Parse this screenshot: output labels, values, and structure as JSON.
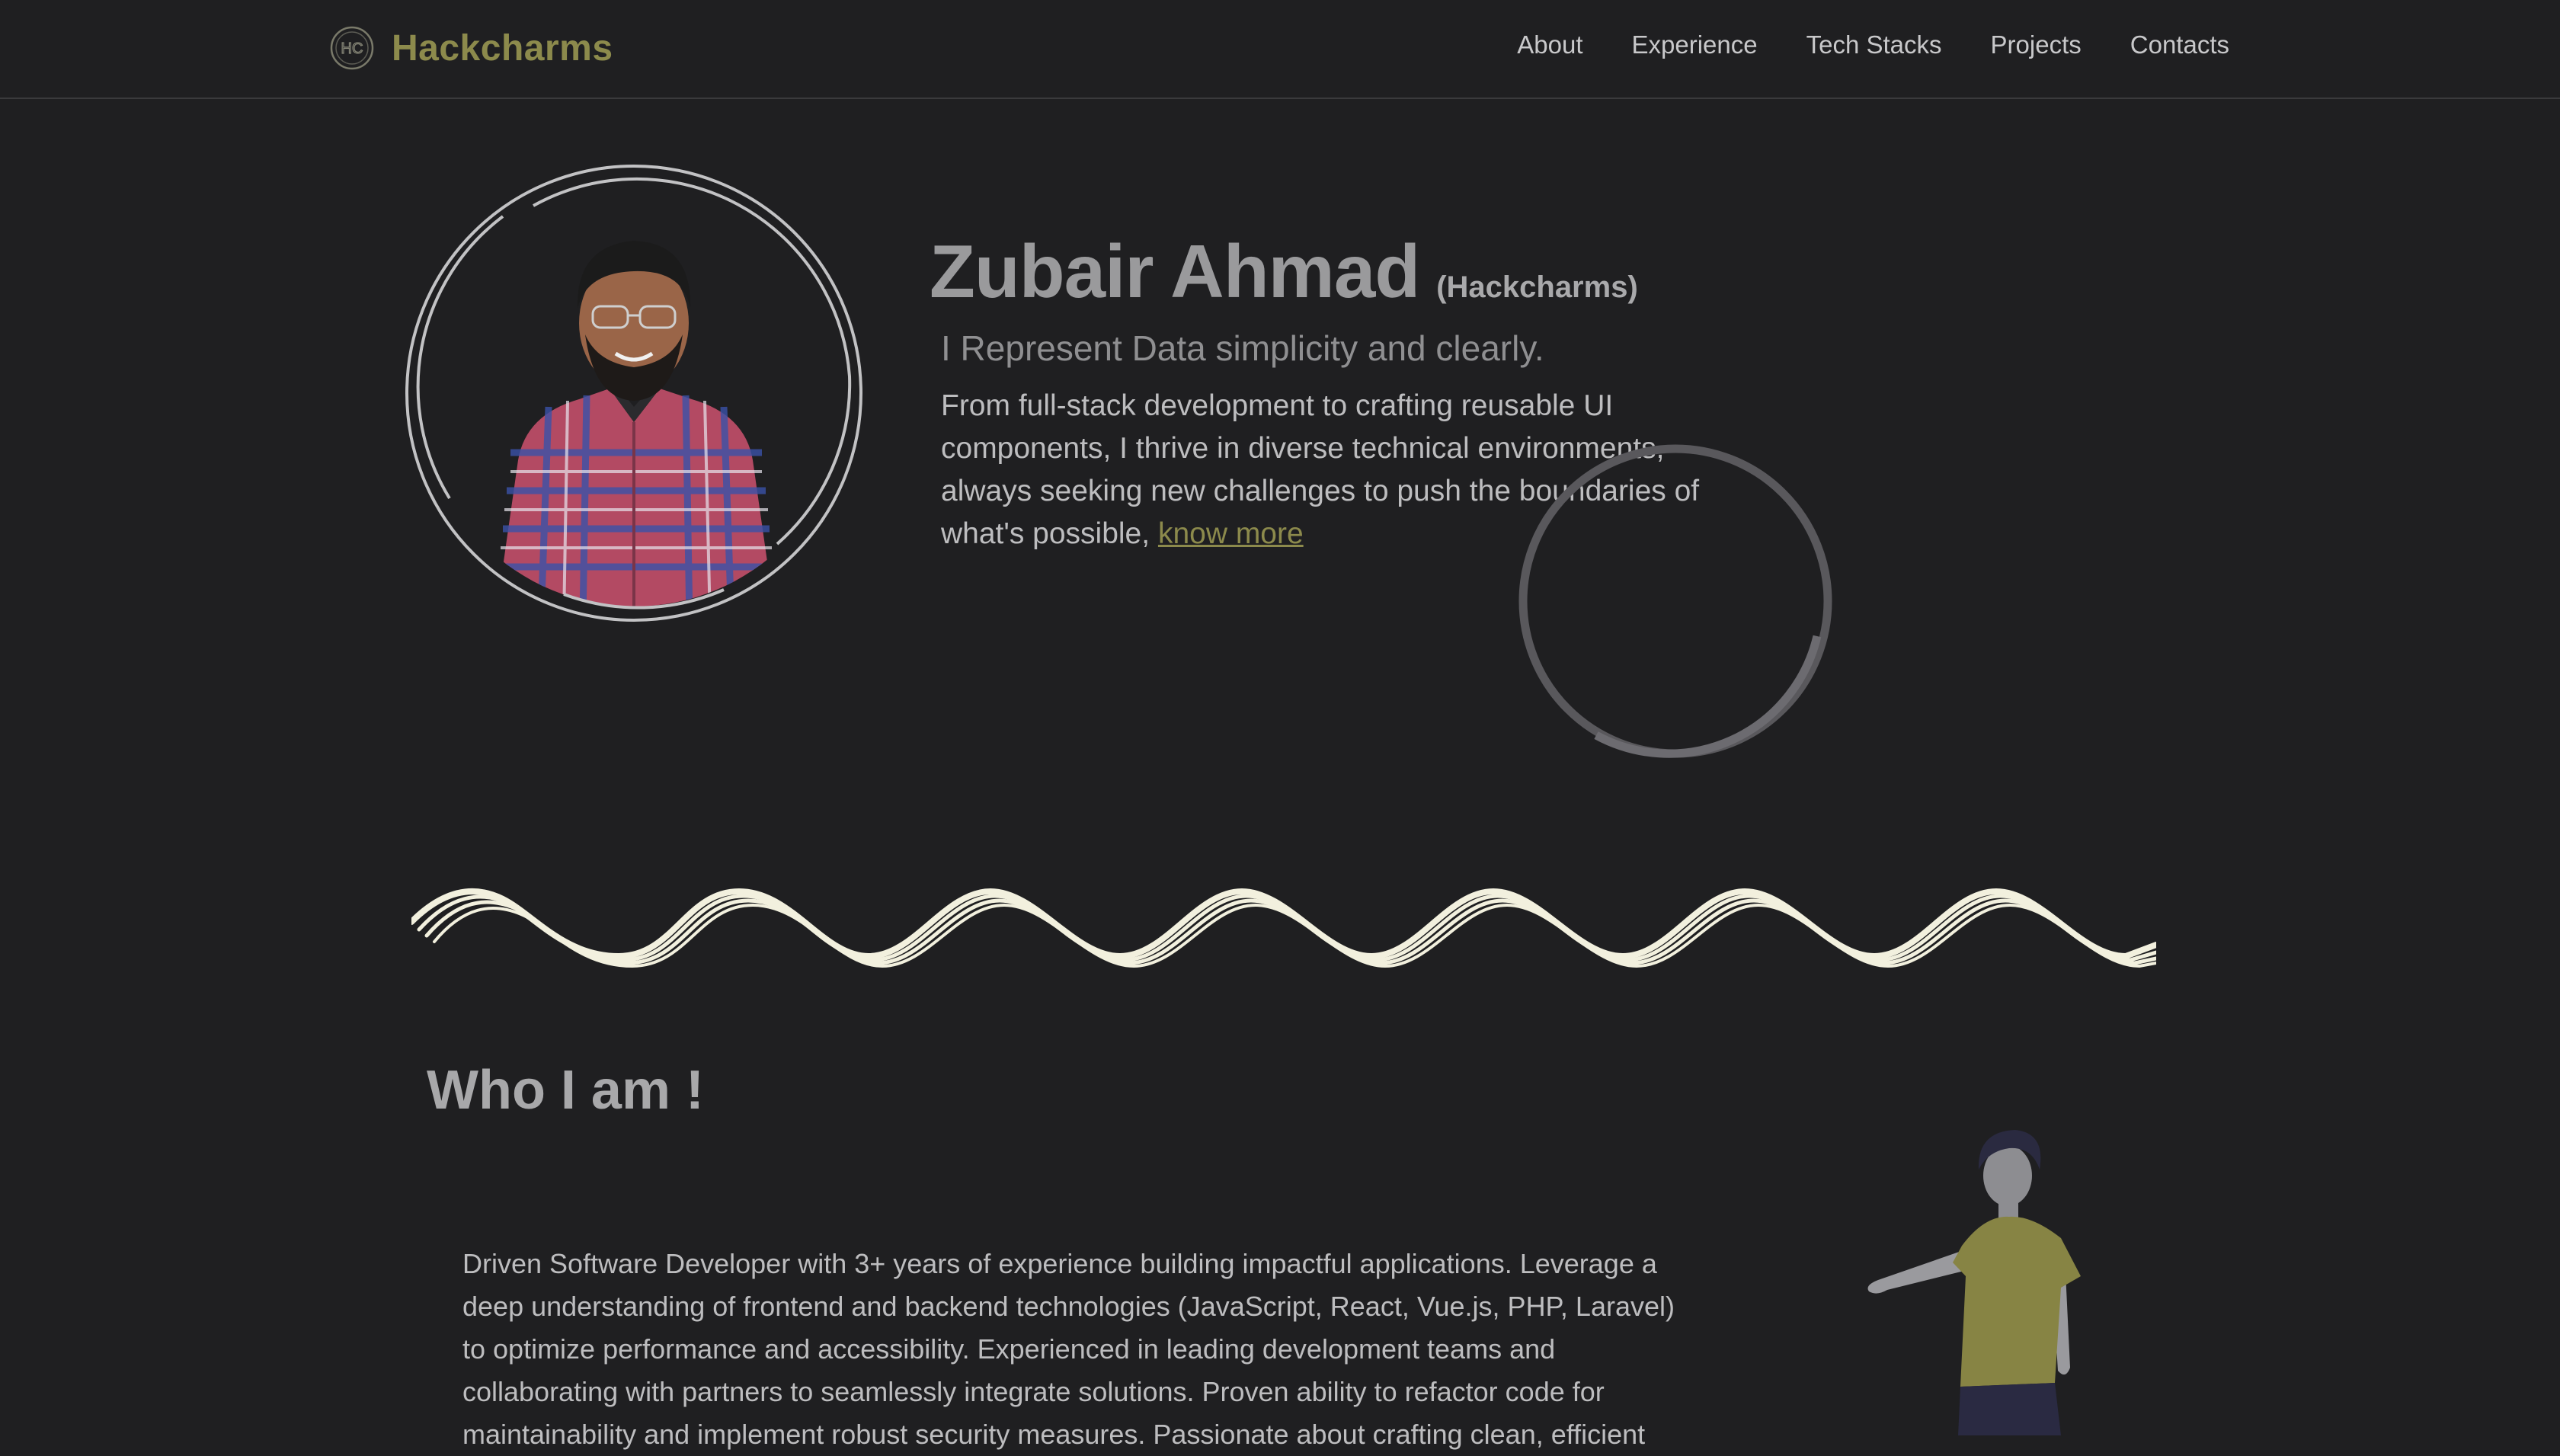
{
  "brand": {
    "name": "Hackcharms",
    "logo_text": "HC",
    "accent": "#8c8a4c"
  },
  "nav": {
    "links": [
      "About",
      "Experience",
      "Tech Stacks",
      "Projects",
      "Contacts"
    ]
  },
  "hero": {
    "name": "Zubair Ahmad",
    "alias": "(Hackcharms)",
    "tagline": "I Represent Data simplicity and clearly.",
    "description": "From full-stack development to crafting reusable UI components, I thrive in diverse technical environments, always seeking new challenges to push the boundaries of what's possible,",
    "link_text": "know more"
  },
  "who": {
    "title": "Who I am !",
    "description": "Driven Software Developer with 3+ years of experience building impactful applications. Leverage a deep understanding of frontend and backend technologies (JavaScript, React, Vue.js, PHP, Laravel) to optimize performance and accessibility. Experienced in leading development teams and collaborating with partners to seamlessly integrate solutions. Proven ability to refactor code for maintainability and implement robust security measures. Passionate about crafting clean, efficient"
  },
  "colors": {
    "background": "#1f1f21",
    "wave": "#f2f0de",
    "figure_shirt": "#878444"
  }
}
